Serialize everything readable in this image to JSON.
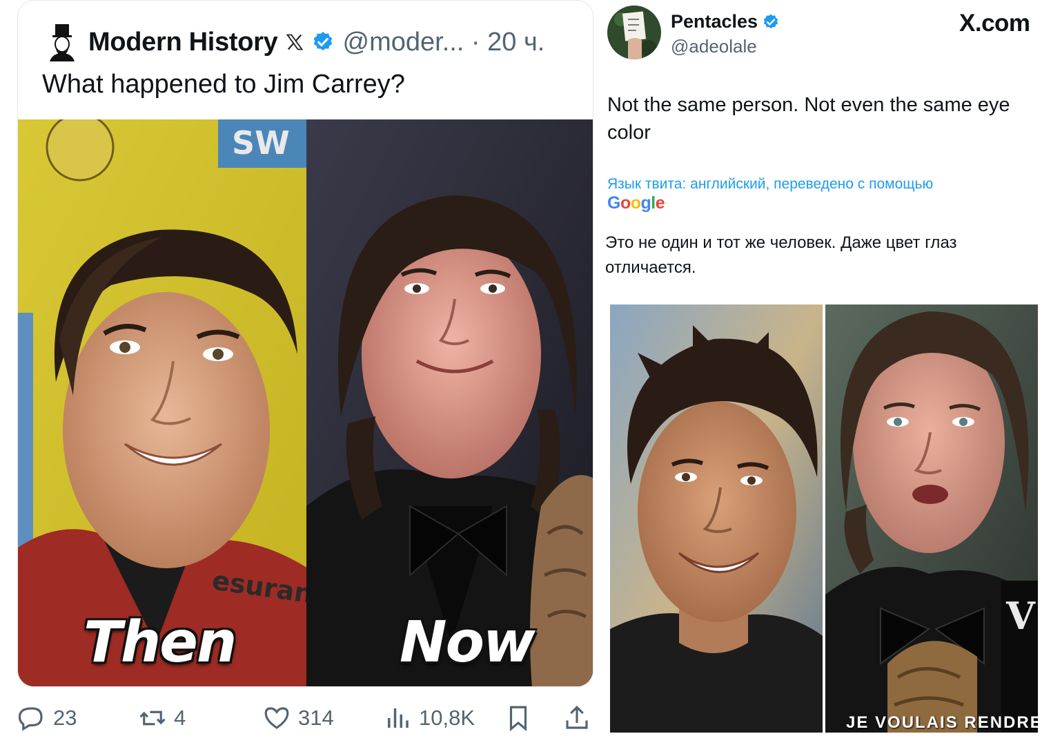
{
  "left_tweet": {
    "name": "Modern History",
    "handle": "@moder... · 20 ч.",
    "text": "What happened to Jim Carrey?",
    "media": {
      "caption_then": "Then",
      "caption_now": "Now",
      "sponsor_text": "esurance",
      "sign_text": "SW"
    },
    "actions": {
      "replies": "23",
      "retweets": "4",
      "likes": "314",
      "views": "10,8K"
    }
  },
  "right_tweet": {
    "name": "Pentacles",
    "handle": "@adeolale",
    "source": "X.com",
    "text": "Not the same person. Not even the same eye color",
    "translation_note": "Язык твита: английский, переведено с помощью",
    "translation_provider": "Google",
    "translated_text": "Это не один и тот же человек. Даже цвет глаз отличается.",
    "media_bottom_text": "JE VOULAIS RENDRE"
  },
  "colors": {
    "verified": "#1d9bf0",
    "secondary_text": "#536471",
    "link": "#1d9bf0"
  },
  "icons": [
    "lincoln-avatar-icon",
    "x-logo-icon",
    "verified-badge-icon",
    "reply-icon",
    "retweet-icon",
    "like-icon",
    "views-icon",
    "bookmark-icon",
    "share-icon"
  ]
}
